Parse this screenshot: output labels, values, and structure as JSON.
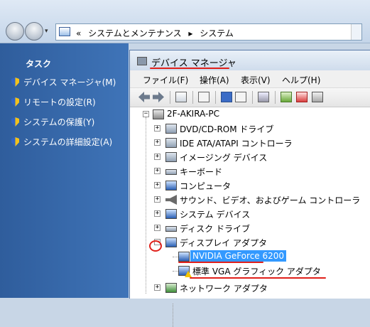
{
  "explorer": {
    "address": {
      "chevron": "«",
      "crumbs": [
        "システムとメンテナンス",
        "システム"
      ],
      "separator": "▸"
    },
    "nav_dropdown": "▾"
  },
  "taskpane": {
    "title": "タスク",
    "items": [
      {
        "label": "デバイス マネージャ(M)",
        "icon": "shield-icon"
      },
      {
        "label": "リモートの設定(R)",
        "icon": "shield-icon"
      },
      {
        "label": "システムの保護(Y)",
        "icon": "shield-icon"
      },
      {
        "label": "システムの詳細設定(A)",
        "icon": "shield-icon"
      }
    ]
  },
  "device_manager": {
    "title": "デバイス マネージャ",
    "menu": [
      "ファイル(F)",
      "操作(A)",
      "表示(V)",
      "ヘルプ(H)"
    ],
    "tree": {
      "root": "2F-AKIRA-PC",
      "categories": [
        "DVD/CD-ROM ドライブ",
        "IDE ATA/ATAPI コントローラ",
        "イメージング デバイス",
        "キーボード",
        "コンピュータ",
        "サウンド、ビデオ、およびゲーム コントローラ",
        "システム デバイス",
        "ディスク ドライブ",
        "ディスプレイ アダプタ",
        "ネットワーク アダプタ"
      ],
      "display_children": [
        {
          "label": "NVIDIA GeForce 6200",
          "selected": true
        },
        {
          "label": "標準 VGA グラフィック アダプタ",
          "warning": true
        }
      ],
      "expander_collapsed": "+",
      "expander_expanded": "−"
    }
  },
  "colors": {
    "selection": "#3399ff",
    "annotation": "#e0201a",
    "taskpane": "#3f74b8"
  }
}
